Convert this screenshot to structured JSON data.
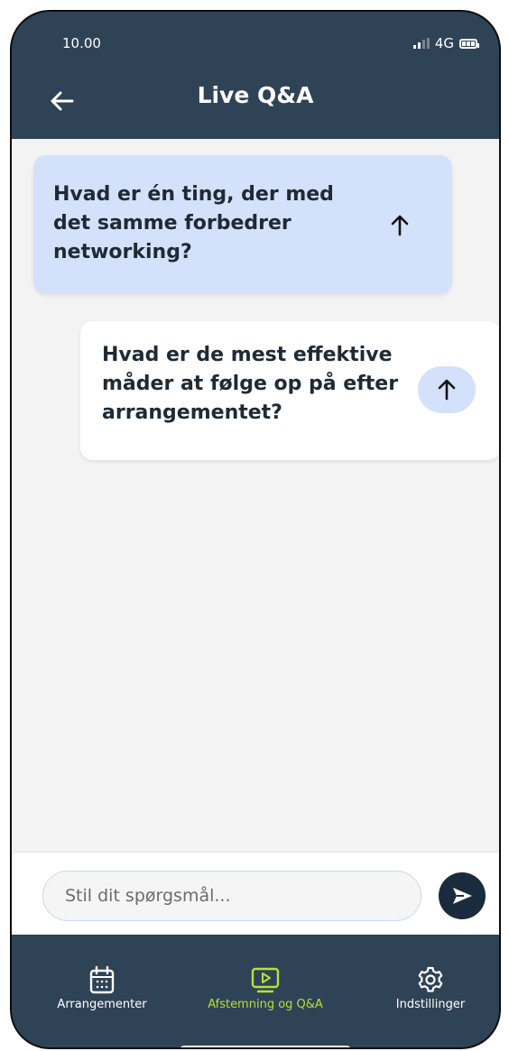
{
  "status_bar": {
    "time": "10.00",
    "network": "4G"
  },
  "header": {
    "title": "Live Q&A",
    "back_icon": "arrow-left-icon"
  },
  "questions": [
    {
      "text": "Hvad er én ting, der med det samme forbedrer networking?",
      "upvote_icon": "arrow-up-icon"
    },
    {
      "text": "Hvad er de mest effektive måder at følge op på efter arrangementet?",
      "upvote_icon": "arrow-up-icon"
    }
  ],
  "composer": {
    "placeholder": "Stil dit spørgsmål...",
    "send_icon": "send-icon"
  },
  "bottom_nav": [
    {
      "label": "Arrangementer",
      "icon": "calendar-icon"
    },
    {
      "label": "Afstemning og Q&A",
      "icon": "play-screen-icon",
      "active": true
    },
    {
      "label": "Indstillinger",
      "icon": "gear-icon"
    }
  ],
  "colors": {
    "header_bg": "#2f4356",
    "accent": "#b8df3a",
    "bubble_highlight": "#d4e1fb",
    "send_bg": "#1a2b3e"
  }
}
